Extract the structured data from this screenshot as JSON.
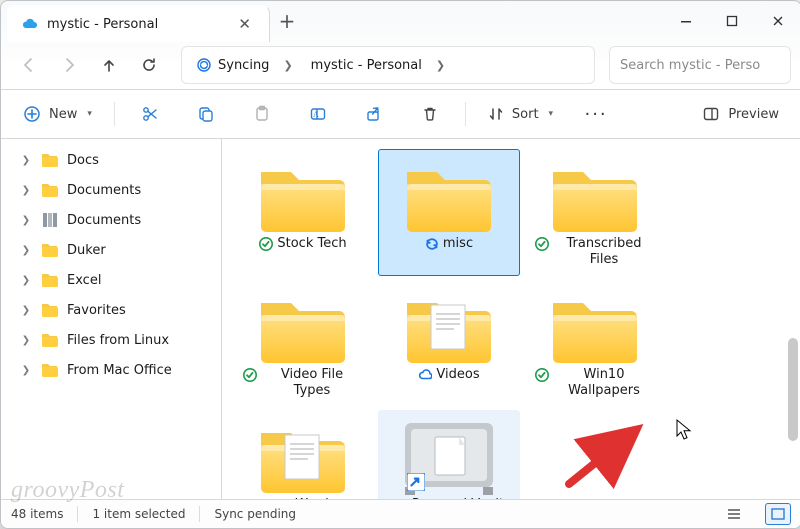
{
  "window": {
    "tab_title": "mystic - Personal",
    "search_placeholder": "Search mystic - Perso"
  },
  "nav": {
    "back_enabled": false,
    "forward_enabled": false,
    "breadcrumbs": [
      {
        "label": "Syncing",
        "icon": "sync"
      },
      {
        "label": "mystic - Personal"
      }
    ]
  },
  "toolbar": {
    "new_label": "New",
    "sort_label": "Sort",
    "preview_label": "Preview"
  },
  "sidebar": {
    "items": [
      {
        "label": "Docs",
        "icon": "folder"
      },
      {
        "label": "Documents",
        "icon": "folder"
      },
      {
        "label": "Documents",
        "icon": "library"
      },
      {
        "label": "Duker",
        "icon": "folder"
      },
      {
        "label": "Excel",
        "icon": "folder"
      },
      {
        "label": "Favorites",
        "icon": "folder"
      },
      {
        "label": "Files from Linux",
        "icon": "folder"
      },
      {
        "label": "From Mac Office",
        "icon": "folder"
      }
    ]
  },
  "content": {
    "items": [
      {
        "label": "Stock Tech",
        "kind": "folder",
        "status": "synced"
      },
      {
        "label": "misc",
        "kind": "folder",
        "status": "syncing",
        "selected": true
      },
      {
        "label": "Transcribed Files",
        "kind": "folder",
        "status": "synced"
      },
      {
        "label": "Video File Types",
        "kind": "folder",
        "status": "synced"
      },
      {
        "label": "Videos",
        "kind": "folder-docs",
        "status": "cloud"
      },
      {
        "label": "Win10 Wallpapers",
        "kind": "folder",
        "status": "synced"
      },
      {
        "label": "Word",
        "kind": "folder-docs",
        "status": "cloud"
      },
      {
        "label": "Personal Vault",
        "kind": "vault",
        "status": "syncing",
        "hover": true,
        "shortcut": true
      }
    ]
  },
  "status": {
    "count_label": "48 items",
    "selection_label": "1 item selected",
    "sync_label": "Sync pending"
  },
  "watermark": "groovyPost"
}
